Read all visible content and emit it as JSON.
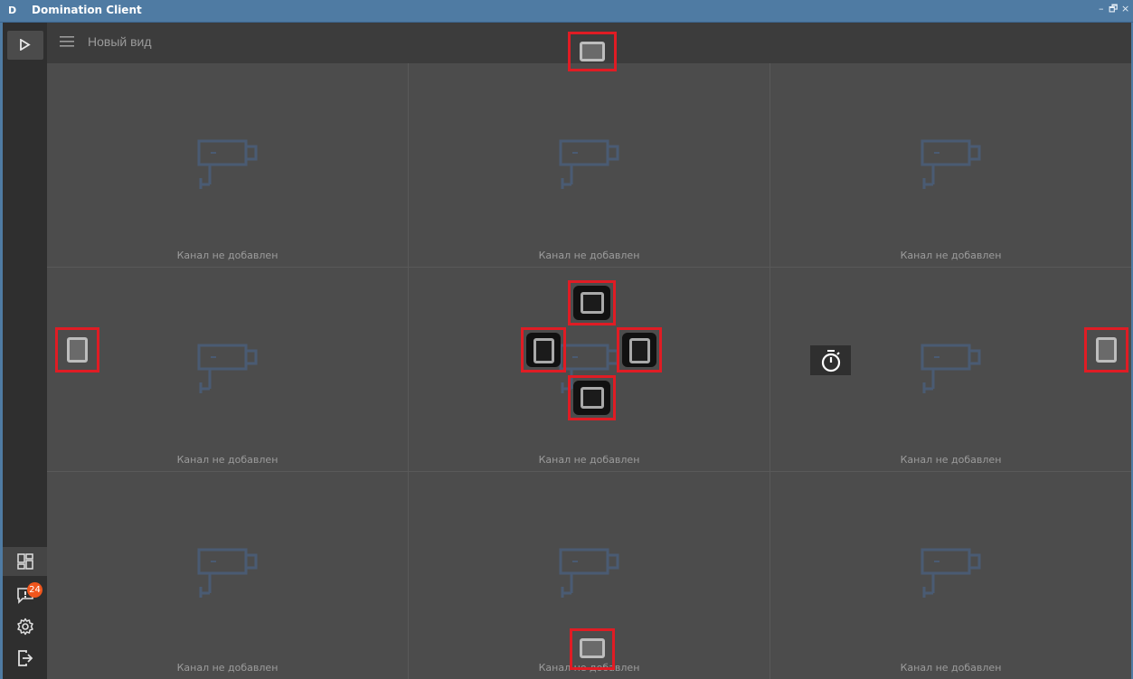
{
  "window": {
    "logo": "D",
    "title": "Domination Client",
    "controls": {
      "minimize": "–",
      "maximize": "🗗",
      "close": "×"
    }
  },
  "sidebar": {
    "events_badge": "24",
    "items": [
      "play-icon",
      "layouts-icon",
      "events-icon",
      "settings-icon",
      "logout-icon"
    ]
  },
  "header": {
    "view_title": "Новый вид"
  },
  "grid": {
    "cells": [
      {
        "label": "Канал не добавлен"
      },
      {
        "label": "Канал не добавлен"
      },
      {
        "label": "Канал не добавлен"
      },
      {
        "label": "Канал не добавлен"
      },
      {
        "label": "Канал не добавлен"
      },
      {
        "label": "Канал не добавлен"
      },
      {
        "label": "Канал не добавлен"
      },
      {
        "label": "Канал не добавлен"
      },
      {
        "label": "Канал не добавлен"
      }
    ]
  },
  "colors": {
    "titlebar": "#4f7ba3",
    "highlight": "#e01c24",
    "badge": "#f0561d",
    "camera_icon": "#4a5b73"
  }
}
